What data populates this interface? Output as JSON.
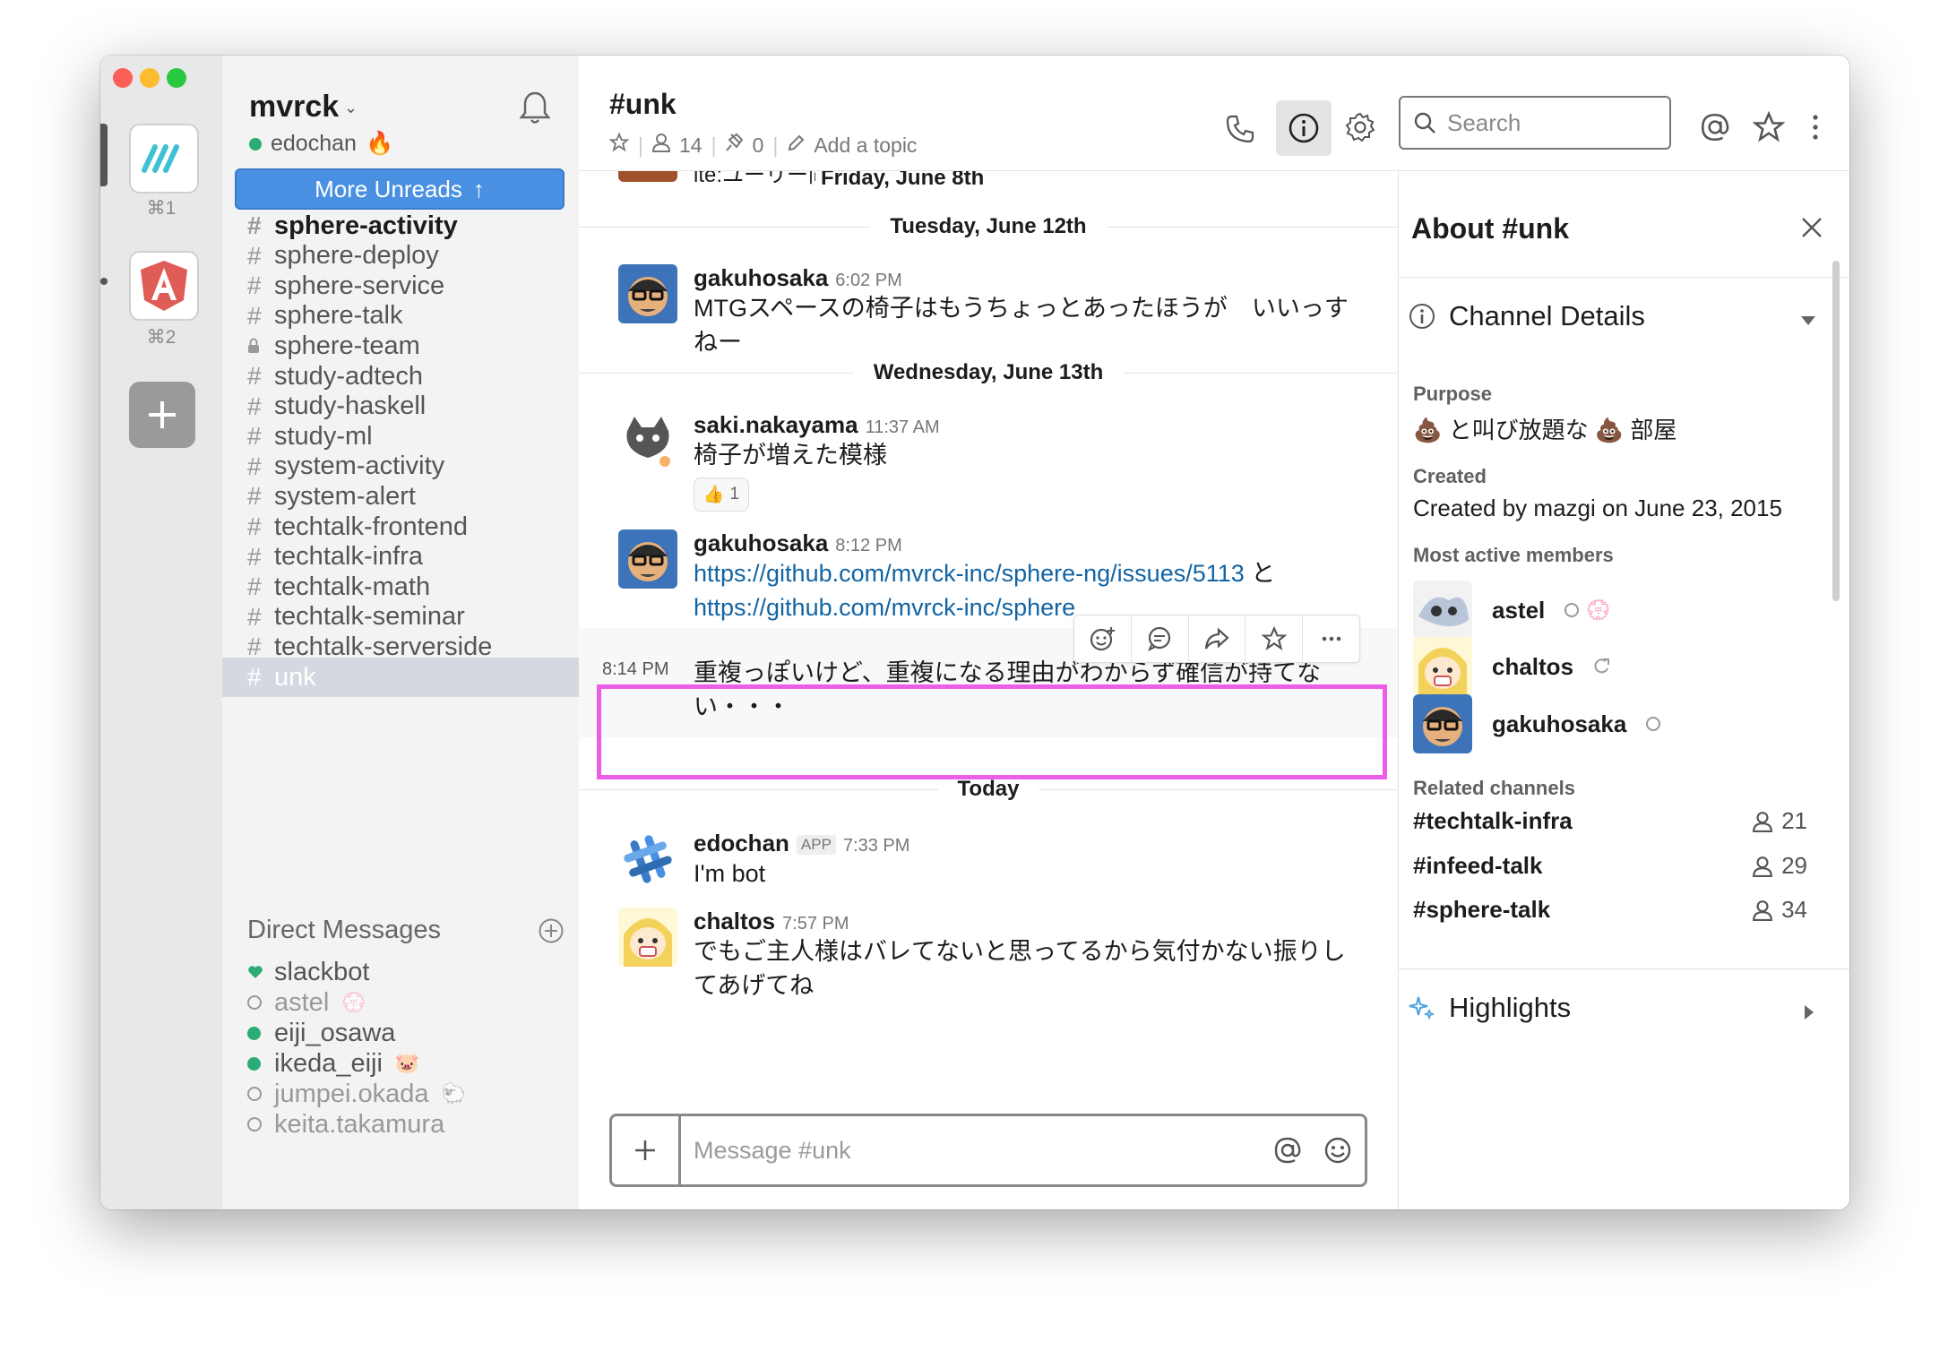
{
  "teams": [
    {
      "name": "mvrck",
      "shortcut": "⌘1",
      "color": "#3ec1d3"
    },
    {
      "name": "angular",
      "shortcut": "⌘2",
      "color": "#d9534f"
    }
  ],
  "sidebar": {
    "workspace": "mvrck",
    "user": "edochan",
    "user_emoji": "🔥",
    "more_unreads": "More Unreads",
    "channels": [
      {
        "name": "sphere-activity",
        "type": "public",
        "bold": true
      },
      {
        "name": "sphere-deploy",
        "type": "public"
      },
      {
        "name": "sphere-service",
        "type": "public"
      },
      {
        "name": "sphere-talk",
        "type": "public"
      },
      {
        "name": "sphere-team",
        "type": "private"
      },
      {
        "name": "study-adtech",
        "type": "public"
      },
      {
        "name": "study-haskell",
        "type": "public"
      },
      {
        "name": "study-ml",
        "type": "public"
      },
      {
        "name": "system-activity",
        "type": "public"
      },
      {
        "name": "system-alert",
        "type": "public"
      },
      {
        "name": "techtalk-frontend",
        "type": "public"
      },
      {
        "name": "techtalk-infra",
        "type": "public"
      },
      {
        "name": "techtalk-math",
        "type": "public"
      },
      {
        "name": "techtalk-seminar",
        "type": "public"
      },
      {
        "name": "techtalk-serverside",
        "type": "public"
      },
      {
        "name": "unk",
        "type": "public",
        "active": true
      }
    ],
    "dm_header": "Direct Messages",
    "dms": [
      {
        "name": "slackbot",
        "presence": "heart",
        "emoji": ""
      },
      {
        "name": "astel",
        "presence": "away",
        "emoji": "💮"
      },
      {
        "name": "eiji_osawa",
        "presence": "online",
        "emoji": ""
      },
      {
        "name": "ikeda_eiji",
        "presence": "online",
        "emoji": "🐷"
      },
      {
        "name": "jumpei.okada",
        "presence": "away",
        "emoji": "🐑"
      },
      {
        "name": "keita.takamura",
        "presence": "away",
        "emoji": ""
      }
    ]
  },
  "header": {
    "channel": "#unk",
    "members": "14",
    "pins": "0",
    "topic": "Add a topic",
    "search_placeholder": "Search"
  },
  "messages": {
    "partial_text": "ite:ユーリー同省た",
    "partial_day": "Friday, June 8th",
    "days": [
      "Tuesday, June 12th",
      "Wednesday, June 13th",
      "Today"
    ],
    "items": [
      {
        "user": "gakuhosaka",
        "time": "6:02 PM",
        "line1": "MTGスペースの椅子はもうちょっとあったほうが　いいっす",
        "line2": "ねー"
      },
      {
        "user": "saki.nakayama",
        "time": "11:37 AM",
        "line1": "椅子が増えた模様",
        "reaction_emoji": "👍",
        "reaction_count": "1"
      },
      {
        "user": "gakuhosaka",
        "time": "8:12 PM",
        "link1": "https://github.com/mvrck-inc/sphere-ng/issues/5113",
        "after_link1": " と",
        "link2": "https://github.com/mvrck-inc/sphere"
      },
      {
        "time": "8:14 PM",
        "line1": "重複っぽいけど、重複になる理由がわからず確信が持てな",
        "line2": "い・・・"
      },
      {
        "user": "edochan",
        "badge": "APP",
        "time": "7:33 PM",
        "line1": "I'm bot"
      },
      {
        "user": "chaltos",
        "time": "7:57 PM",
        "line1": "でもご主人様はバレてないと思ってるから気付かない振りし",
        "line2": "てあげてね"
      }
    ],
    "composer_placeholder": "Message #unk"
  },
  "panel": {
    "title": "About #unk",
    "details": "Channel Details",
    "purpose_label": "Purpose",
    "purpose": "💩 と叫び放題な 💩 部屋",
    "created_label": "Created",
    "created": "Created by mazgi on June 23, 2015",
    "members_label": "Most active members",
    "members": [
      {
        "name": "astel",
        "status": "away",
        "emoji": "💮"
      },
      {
        "name": "chaltos",
        "status": "external",
        "emoji": ""
      },
      {
        "name": "gakuhosaka",
        "status": "away",
        "emoji": ""
      }
    ],
    "related_label": "Related channels",
    "related": [
      {
        "name": "#techtalk-infra",
        "count": "21"
      },
      {
        "name": "#infeed-talk",
        "count": "29"
      },
      {
        "name": "#sphere-talk",
        "count": "34"
      }
    ],
    "highlights": "Highlights"
  },
  "colors": {
    "accent_blue": "#4a90e2",
    "online_green": "#2bac76",
    "highlight_magenta": "#ea5ee8",
    "link": "#1264a3"
  }
}
